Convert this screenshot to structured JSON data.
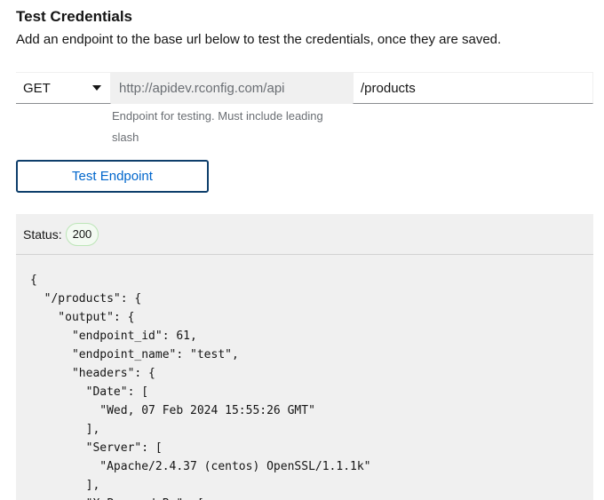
{
  "section": {
    "title": "Test Credentials",
    "description": "Add an endpoint to the base url below to test the credentials, once they are saved."
  },
  "request": {
    "method": "GET",
    "base_url": "http://apidev.rconfig.com/api",
    "endpoint_value": "/products",
    "helper_text": "Endpoint for testing. Must include leading slash"
  },
  "actions": {
    "test_label": "Test Endpoint"
  },
  "result": {
    "status_label": "Status:",
    "status_code": "200",
    "json_lines": [
      "{",
      "  \"/products\": {",
      "    \"output\": {",
      "      \"endpoint_id\": 61,",
      "      \"endpoint_name\": \"test\",",
      "      \"headers\": {",
      "        \"Date\": [",
      "          \"Wed, 07 Feb 2024 15:55:26 GMT\"",
      "        ],",
      "        \"Server\": [",
      "          \"Apache/2.4.37 (centos) OpenSSL/1.1.1k\"",
      "        ],",
      "        \"X-Powered-By\": ["
    ]
  },
  "colors": {
    "link_blue": "#0066cc",
    "button_border": "#0e3e6b",
    "panel_bg": "#f0f0f0"
  }
}
